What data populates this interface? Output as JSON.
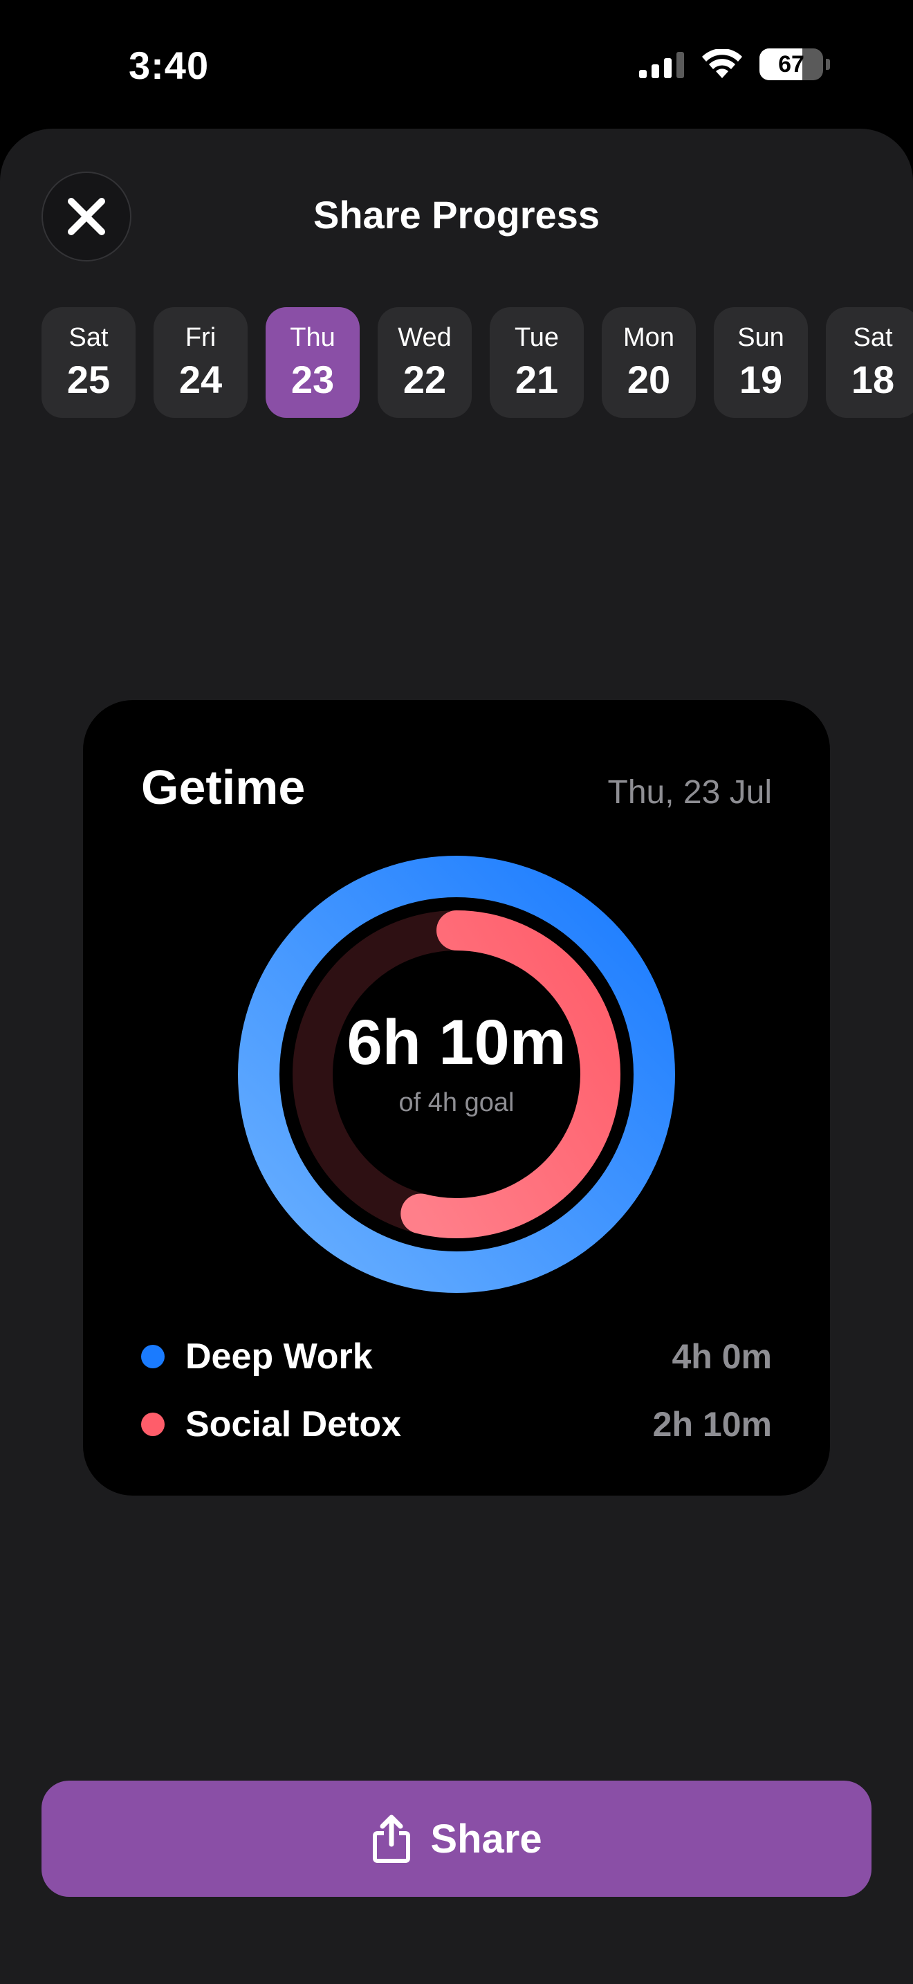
{
  "status_bar": {
    "time": "3:40",
    "battery_percent": "67",
    "battery_level": 0.67,
    "icons": [
      "cellular-signal-icon",
      "wifi-icon",
      "battery-icon"
    ]
  },
  "header": {
    "title": "Share Progress",
    "close_icon": "close-icon"
  },
  "dates": [
    {
      "dow": "Sat",
      "dom": "25",
      "selected": false
    },
    {
      "dow": "Fri",
      "dom": "24",
      "selected": false
    },
    {
      "dow": "Thu",
      "dom": "23",
      "selected": true
    },
    {
      "dow": "Wed",
      "dom": "22",
      "selected": false
    },
    {
      "dow": "Tue",
      "dom": "21",
      "selected": false
    },
    {
      "dow": "Mon",
      "dom": "20",
      "selected": false
    },
    {
      "dow": "Sun",
      "dom": "19",
      "selected": false
    },
    {
      "dow": "Sat",
      "dom": "18",
      "selected": false
    }
  ],
  "card": {
    "app_name": "Getime",
    "date": "Thu, 23 Jul",
    "total": "6h 10m",
    "goal": "of 4h goal",
    "rings": [
      {
        "name": "Deep Work",
        "progress": 1.0,
        "color": "#1a7bff",
        "color_light": "#6ab0ff"
      },
      {
        "name": "Social Detox",
        "progress": 0.54,
        "color": "#ff5d6a",
        "color_light": "#ff7f8a",
        "track": "#2e1013"
      }
    ],
    "legend": [
      {
        "label": "Deep Work",
        "value": "4h 0m",
        "color": "#1a7bff"
      },
      {
        "label": "Social Detox",
        "value": "2h 10m",
        "color": "#ff5d6a"
      }
    ]
  },
  "share_button": {
    "label": "Share",
    "icon": "share-icon"
  },
  "colors": {
    "accent": "#8a4fa6",
    "sheet_bg": "#1c1c1e",
    "chip_bg": "#2c2c2e",
    "card_bg": "#000000",
    "muted_text": "#8e8e93"
  }
}
